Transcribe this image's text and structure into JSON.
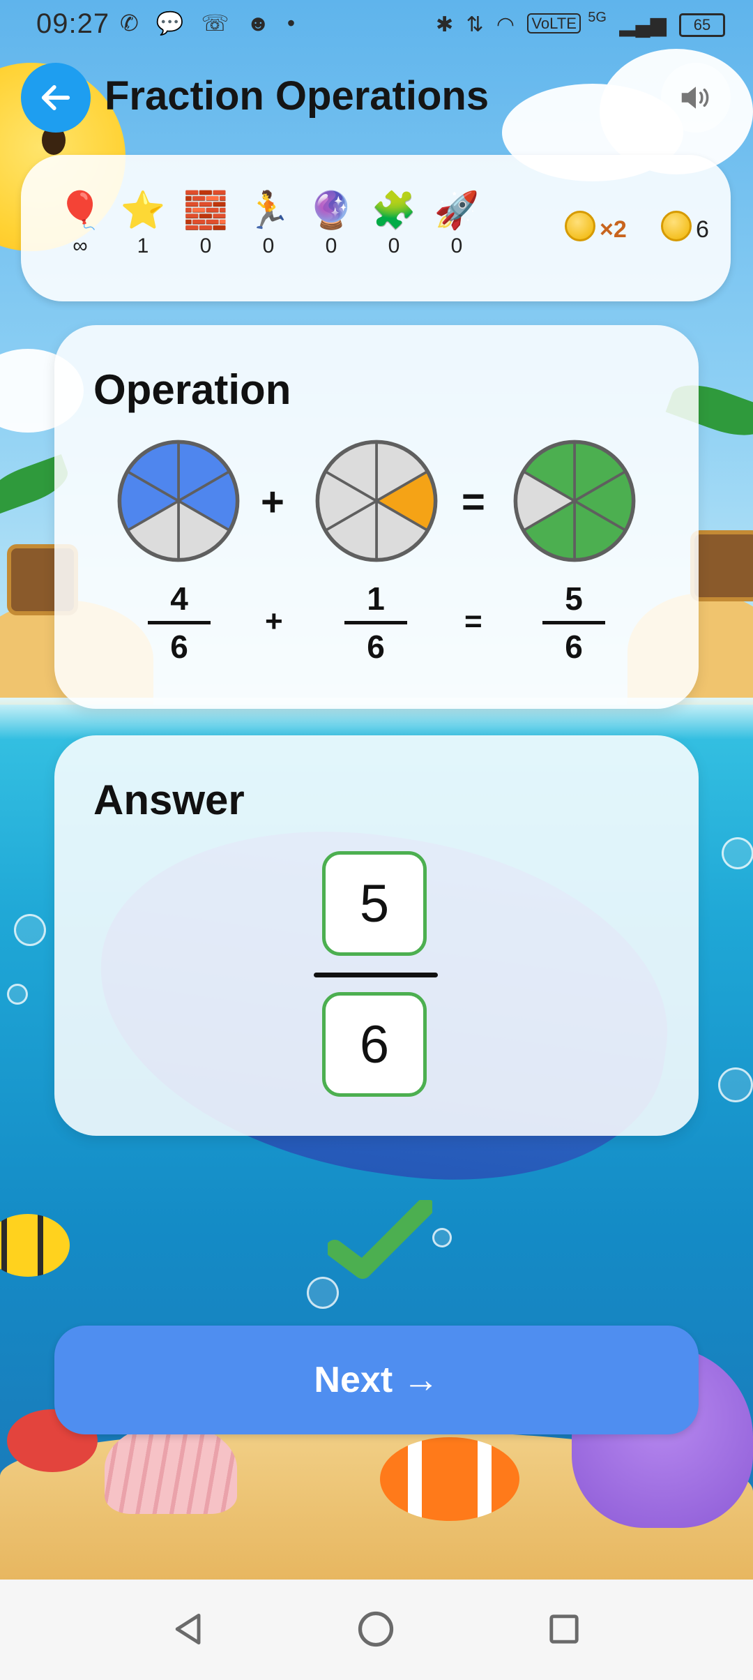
{
  "status_bar": {
    "time": "09:27",
    "left_icons": [
      "whatsapp-icon",
      "chat-icon",
      "missed-call-icon",
      "app-icon",
      "dot-icon"
    ],
    "network": "5G",
    "volte": "VoLTE",
    "battery": "65"
  },
  "header": {
    "title": "Fraction Operations",
    "back_icon": "arrow-left-icon",
    "sound_icon": "speaker-icon"
  },
  "powerups": [
    {
      "name": "balloon",
      "icon": "🎈",
      "count": "∞"
    },
    {
      "name": "star",
      "icon": "⭐",
      "count": "1"
    },
    {
      "name": "brick",
      "icon": "🧱",
      "count": "0"
    },
    {
      "name": "runner",
      "icon": "🏃",
      "count": "0"
    },
    {
      "name": "crystal-ball",
      "icon": "🔮",
      "count": "0"
    },
    {
      "name": "puzzle",
      "icon": "🧩",
      "count": "0"
    },
    {
      "name": "rocket",
      "icon": "🚀",
      "count": "0"
    }
  ],
  "coins": {
    "multiplier": "×2",
    "total": "6",
    "coin_color": "#f0b400"
  },
  "operation": {
    "title": "Operation",
    "operator": "+",
    "equals": "=",
    "left": {
      "numerator": "4",
      "denominator": "6",
      "filled": 4,
      "parts": 6,
      "color": "#4f86ee"
    },
    "right": {
      "numerator": "1",
      "denominator": "6",
      "filled": 1,
      "parts": 6,
      "color": "#f5a316"
    },
    "result": {
      "numerator": "5",
      "denominator": "6",
      "filled": 5,
      "parts": 6,
      "color": "#4caf50"
    }
  },
  "answer": {
    "title": "Answer",
    "numerator": "5",
    "denominator": "6",
    "correct": true
  },
  "next_button": {
    "label": "Next →",
    "color": "#4f8ef0"
  },
  "nav": {
    "back_icon": "nav-back-icon",
    "home_icon": "nav-home-icon",
    "recents_icon": "nav-recents-icon"
  }
}
